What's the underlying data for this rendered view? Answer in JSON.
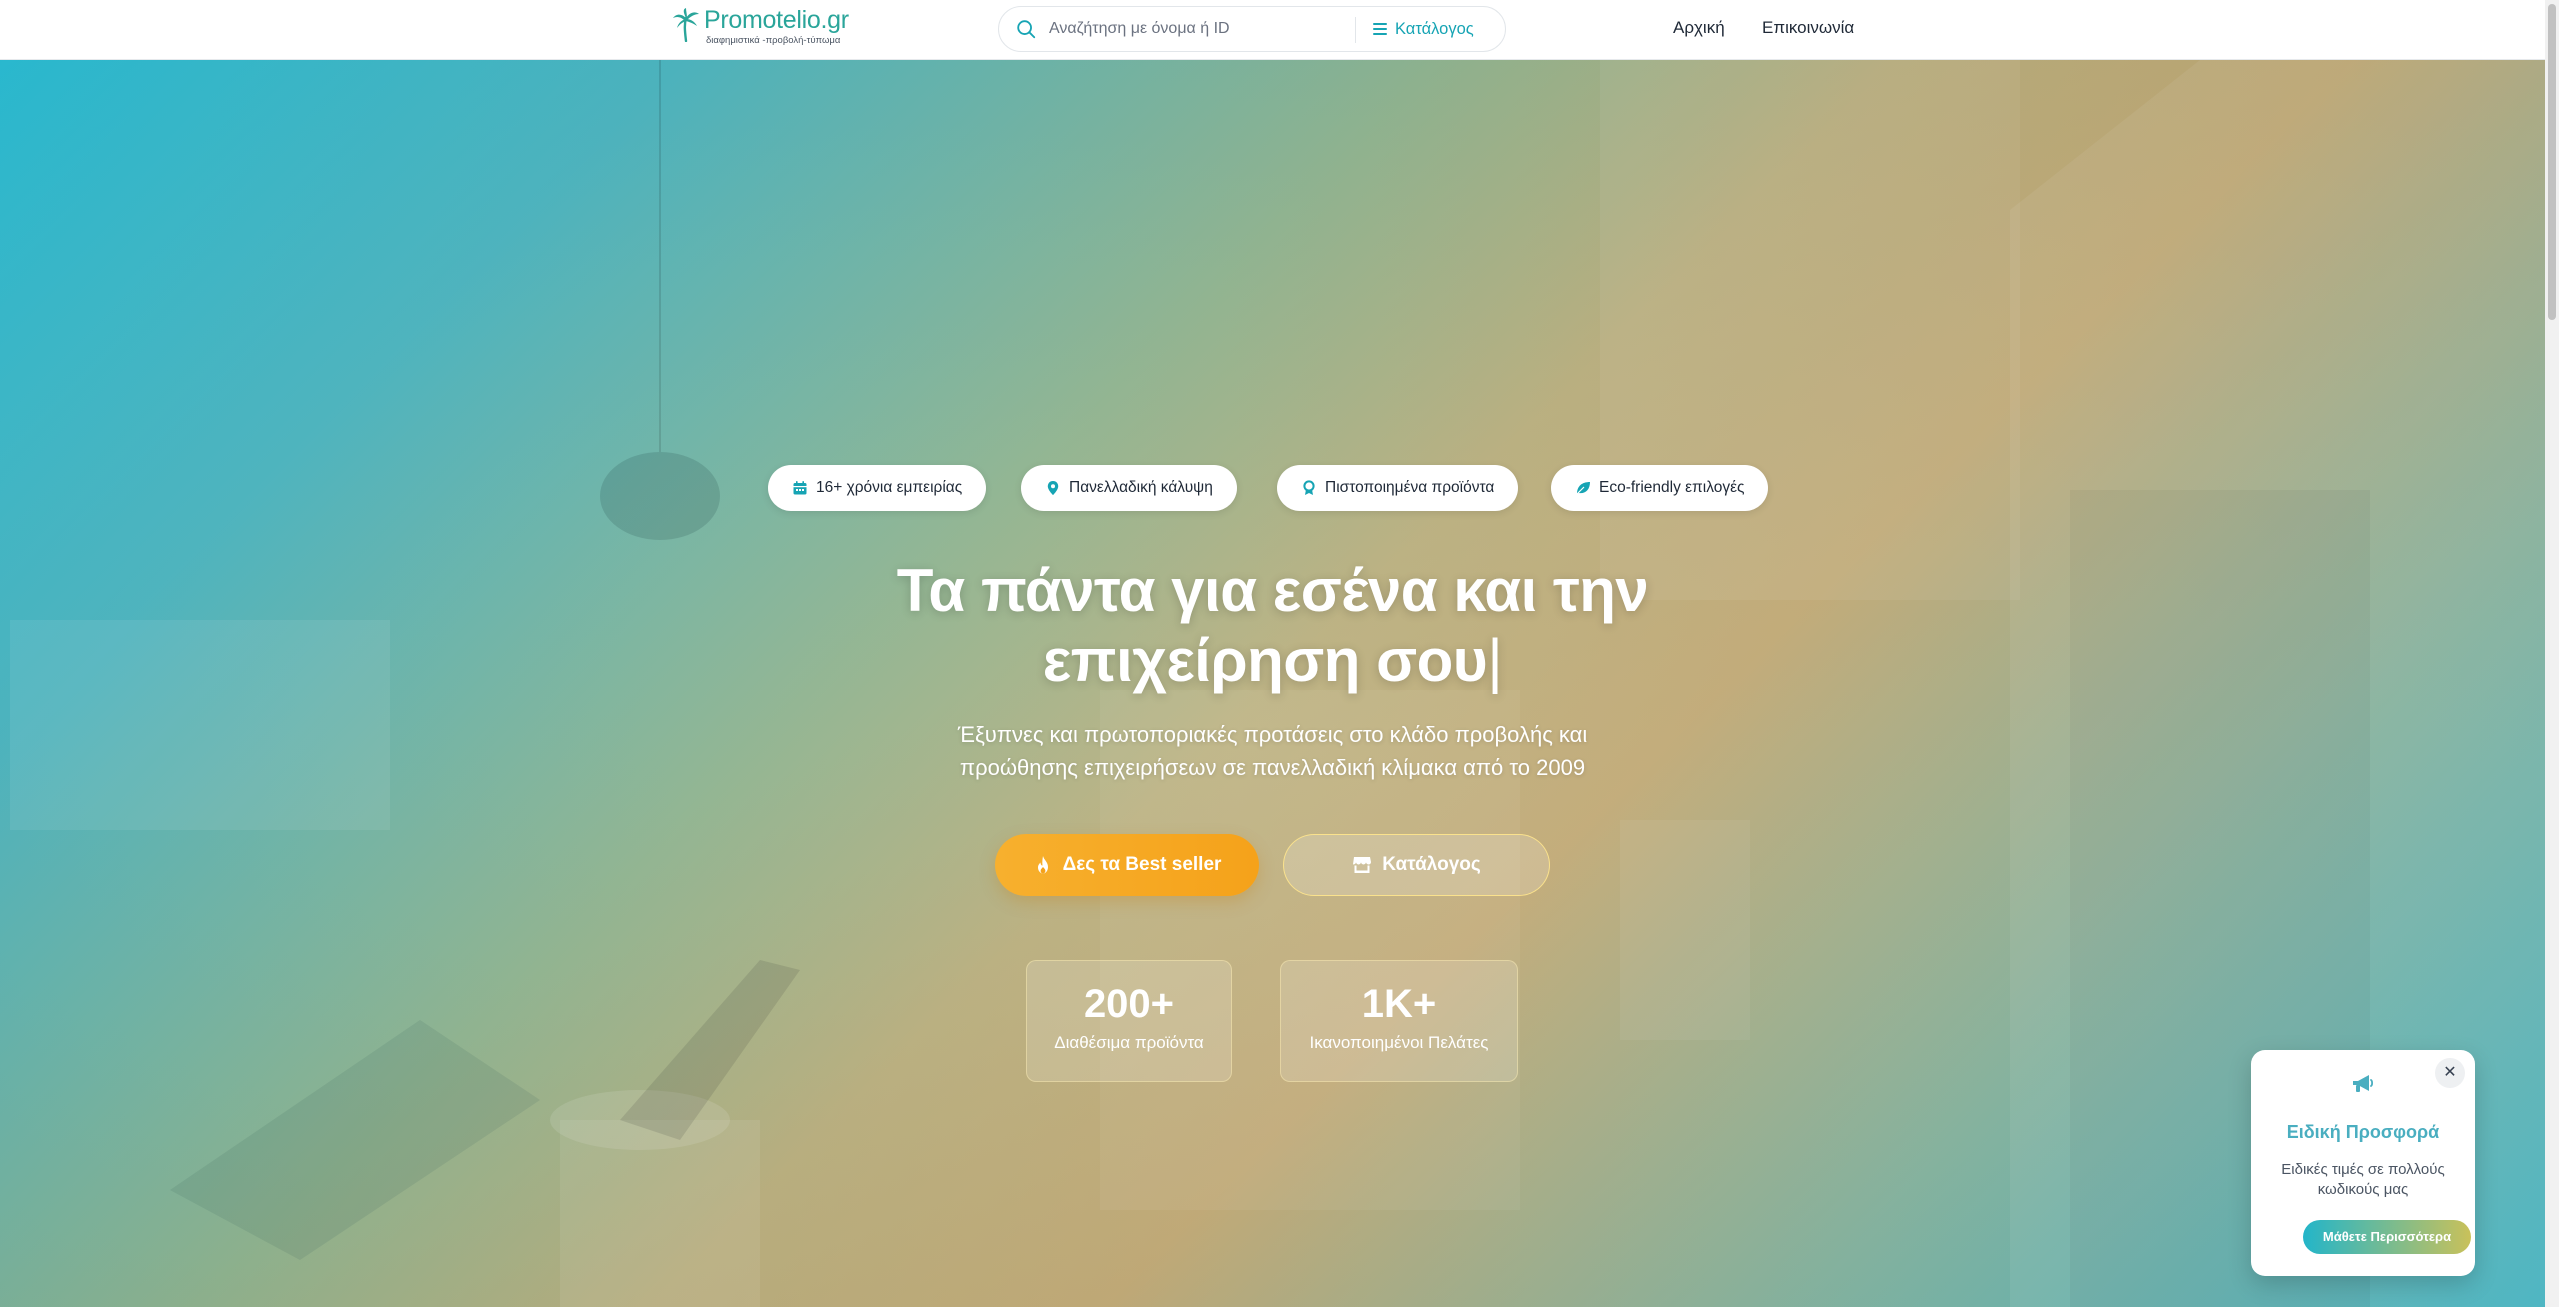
{
  "header": {
    "logo": {
      "name": "Promotelio.gr",
      "tagline": "διαφημιστικά -προβολή-τύπωμα"
    },
    "search": {
      "placeholder": "Αναζήτηση με όνομα ή ID",
      "value": "",
      "catalog_label": "Κατάλογος"
    },
    "nav": [
      {
        "label": "Αρχική"
      },
      {
        "label": "Επικοινωνία"
      }
    ]
  },
  "hero": {
    "badges": [
      {
        "label": "16+ χρόνια εμπειρίας",
        "icon": "calendar-icon"
      },
      {
        "label": "Πανελλαδική κάλυψη",
        "icon": "location-pin-icon"
      },
      {
        "label": "Πιστοποιημένα προϊόντα",
        "icon": "award-icon"
      },
      {
        "label": "Eco-friendly επιλογές",
        "icon": "leaf-icon"
      }
    ],
    "title_line1": "Τα πάντα για εσένα και την",
    "title_line2": "επιχείρηση σου",
    "title_caret": "|",
    "subtitle_line1": "Έξυπνες και πρωτοποριακές προτάσεις στο κλάδο προβολής και",
    "subtitle_line2": "προώθησης επιχειρήσεων σε πανελλαδική κλίμακα από το 2009",
    "buttons": {
      "bestseller": {
        "label": "Δες τα Best seller",
        "icon": "fire-icon"
      },
      "catalog": {
        "label": "Κατάλογος",
        "icon": "store-icon"
      }
    },
    "stats": [
      {
        "value": "200+",
        "label": "Διαθέσιμα προϊόντα"
      },
      {
        "value": "1K+",
        "label": "Ικανοποιημένοι Πελάτες"
      }
    ]
  },
  "offer": {
    "icon": "megaphone-icon",
    "title": "Ειδική Προσφορά",
    "text": "Ειδικές τιμές σε πολλούς κωδικούς μας",
    "button": "Μάθετε Περισσότερα",
    "close": "✕"
  },
  "colors": {
    "brand_teal": "#2aa59a",
    "accent_cyan": "#16a4b4",
    "cta_orange": "#f5a21a",
    "offer_title": "#4aaec0"
  }
}
